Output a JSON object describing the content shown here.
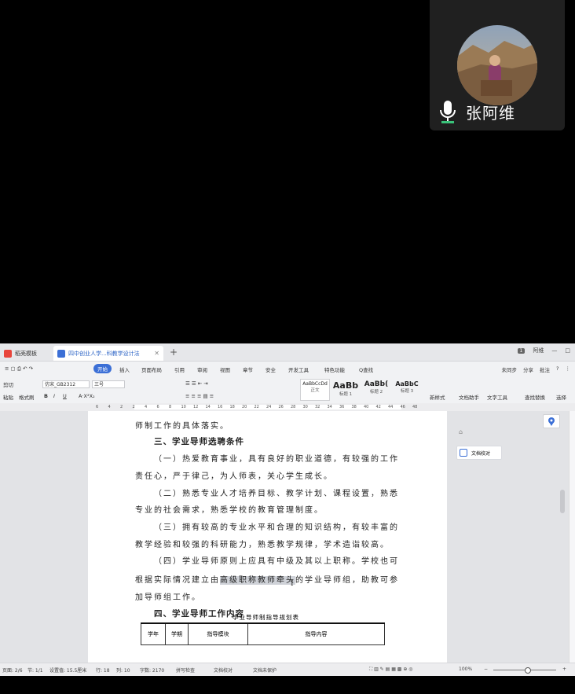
{
  "call": {
    "participant_name": "张阿维"
  },
  "tabs": [
    {
      "label": "稻壳模板",
      "color": "#e8453c"
    },
    {
      "label": "四中创业人学...科教学设计法",
      "color": "#3b6fd6"
    }
  ],
  "titlebar": {
    "page_badge": "1",
    "user": "阿维",
    "minimize": "—",
    "restore": "□"
  },
  "menu": {
    "items": [
      "开始",
      "插入",
      "页面布局",
      "引用",
      "审阅",
      "视图",
      "章节",
      "安全",
      "开发工具",
      "特色功能",
      "Q查找"
    ],
    "active": "开始",
    "right": [
      "未同步",
      "分享",
      "批注",
      "?",
      "⋮"
    ]
  },
  "ribbon": {
    "cut": "剪切",
    "paste": "粘贴",
    "format_painter": "格式刷",
    "font_name": "仿宋_GB2312",
    "font_size": "三号",
    "styles": [
      {
        "sample": "AaBbCcDd",
        "name": "正文"
      },
      {
        "sample": "AaBb",
        "name": "标题 1"
      },
      {
        "sample": "AaBb(",
        "name": "标题 2"
      },
      {
        "sample": "AaBbC",
        "name": "标题 3"
      }
    ],
    "new_style": "新样式",
    "text_tools": "文字工具",
    "doc_assistant": "文档助手",
    "find_replace": "查找替换",
    "select": "选择"
  },
  "ruler": {
    "ticks": [
      "6",
      "4",
      "2",
      "2",
      "4",
      "6",
      "8",
      "10",
      "12",
      "14",
      "16",
      "18",
      "20",
      "22",
      "24",
      "26",
      "28",
      "30",
      "32",
      "34",
      "36",
      "38",
      "40",
      "42",
      "44",
      "46",
      "48"
    ]
  },
  "document": {
    "lines": [
      {
        "text": "师制工作的具体落实。",
        "indent": false,
        "heading": false
      },
      {
        "text": "三、学业导师选聘条件",
        "indent": true,
        "heading": true
      },
      {
        "text": "（一）热爱教育事业，具有良好的职业道德，有较强的工作",
        "indent": true,
        "heading": false
      },
      {
        "text": "责任心，严于律己，为人师表，关心学生成长。",
        "indent": false,
        "heading": false
      },
      {
        "text": "（二）熟悉专业人才培养目标、教学计划、课程设置，熟悉",
        "indent": true,
        "heading": false
      },
      {
        "text": "专业的社会需求，熟悉学校的教育管理制度。",
        "indent": false,
        "heading": false
      },
      {
        "text": "（三）拥有较高的专业水平和合理的知识结构，有较丰富的",
        "indent": true,
        "heading": false
      },
      {
        "text": "教学经验和较强的科研能力，熟悉教学规律，学术造诣较高。",
        "indent": false,
        "heading": false
      },
      {
        "text": "（四）学业导师原则上应具有中级及其以上职称。学校也可",
        "indent": true,
        "heading": false
      }
    ],
    "line_before": "根据实际情况建立由",
    "line_highlight": "高级职称教师牵头",
    "line_after": "的学业导师组，助教可参",
    "line_last": "加导师组工作。",
    "heading4": "四、学业导师工作内容",
    "table_caption": "学业导师制指导规划表",
    "table_headers": [
      "学年",
      "学期",
      "指导模块",
      "指导内容"
    ],
    "caret": "I"
  },
  "side_panel": {
    "doc_check": "文档校对"
  },
  "status": {
    "page": "页面: 2/6",
    "section": "节: 1/1",
    "position": "设置值: 15.5厘米",
    "row": "行: 18",
    "col": "列: 10",
    "words": "字数: 2170",
    "spellcheck": "拼写检查",
    "proofread": "文档校对",
    "protect": "文档未保护",
    "zoom": "100%"
  }
}
